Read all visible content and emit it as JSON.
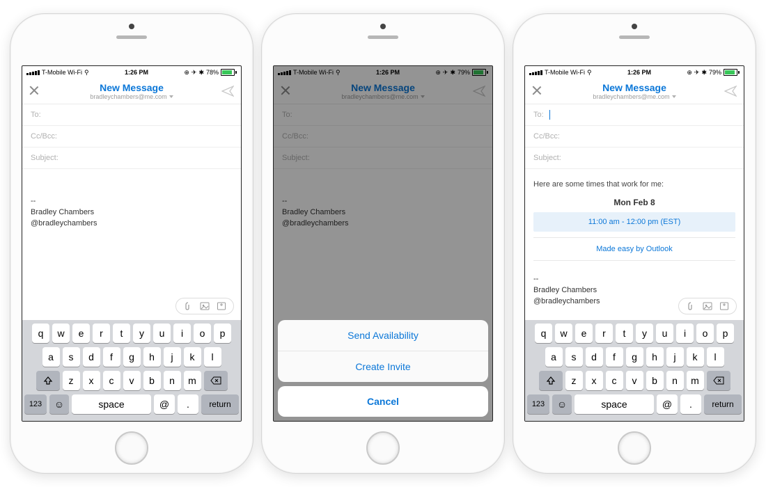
{
  "status": {
    "carrier": "T-Mobile Wi-Fi",
    "time": "1:26 PM",
    "battery1": "78%",
    "battery23": "79%"
  },
  "nav": {
    "title": "New Message",
    "account": "bradleychambers@me.com"
  },
  "fields": {
    "to": "To:",
    "cc": "Cc/Bcc:",
    "subject": "Subject:"
  },
  "signature": {
    "dashes": "--",
    "name": "Bradley Chambers",
    "handle": "@bradleychambers"
  },
  "availability": {
    "intro": "Here are some times that work for me:",
    "date": "Mon Feb 8",
    "slot": "11:00 am - 12:00 pm (EST)",
    "link": "Made easy by Outlook"
  },
  "sheet": {
    "opt1": "Send Availability",
    "opt2": "Create Invite",
    "cancel": "Cancel"
  },
  "keys": {
    "r1": [
      "q",
      "w",
      "e",
      "r",
      "t",
      "y",
      "u",
      "i",
      "o",
      "p"
    ],
    "r2": [
      "a",
      "s",
      "d",
      "f",
      "g",
      "h",
      "j",
      "k",
      "l"
    ],
    "r3": [
      "z",
      "x",
      "c",
      "v",
      "b",
      "n",
      "m"
    ],
    "num": "123",
    "space": "space",
    "at": "@",
    "dot": ".",
    "ret": "return"
  }
}
